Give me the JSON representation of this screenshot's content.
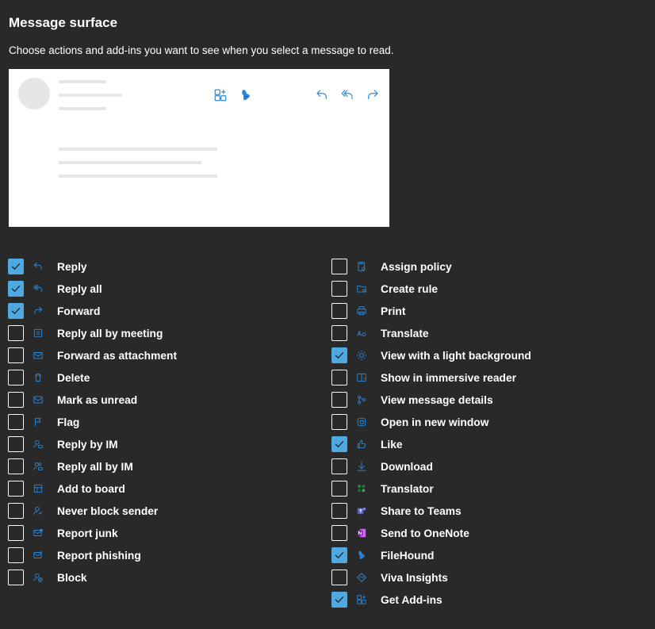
{
  "header": {
    "title": "Message surface",
    "subtitle": "Choose actions and add-ins you want to see when you select a message to read."
  },
  "preview": {
    "icons": [
      "add-ins-icon",
      "filehound-icon",
      "like-icon",
      "light-background-icon",
      "reply-icon",
      "reply-all-icon",
      "forward-icon"
    ]
  },
  "colors": {
    "background": "#292929",
    "accent": "#4fa8e0",
    "icon": "#2b88d8"
  },
  "left_options": [
    {
      "label": "Reply",
      "checked": true,
      "icon": "reply-icon"
    },
    {
      "label": "Reply all",
      "checked": true,
      "icon": "reply-all-icon"
    },
    {
      "label": "Forward",
      "checked": true,
      "icon": "forward-icon"
    },
    {
      "label": "Reply all by meeting",
      "checked": false,
      "icon": "calendar-reply-icon"
    },
    {
      "label": "Forward as attachment",
      "checked": false,
      "icon": "mail-attachment-icon"
    },
    {
      "label": "Delete",
      "checked": false,
      "icon": "trash-icon"
    },
    {
      "label": "Mark as unread",
      "checked": false,
      "icon": "envelope-icon"
    },
    {
      "label": "Flag",
      "checked": false,
      "icon": "flag-icon"
    },
    {
      "label": "Reply by IM",
      "checked": false,
      "icon": "person-chat-icon"
    },
    {
      "label": "Reply all by IM",
      "checked": false,
      "icon": "people-chat-icon"
    },
    {
      "label": "Add to board",
      "checked": false,
      "icon": "board-icon"
    },
    {
      "label": "Never block sender",
      "checked": false,
      "icon": "person-check-icon"
    },
    {
      "label": "Report junk",
      "checked": false,
      "icon": "mail-junk-icon"
    },
    {
      "label": "Report phishing",
      "checked": false,
      "icon": "mail-warning-icon"
    },
    {
      "label": "Block",
      "checked": false,
      "icon": "person-block-icon"
    }
  ],
  "right_options": [
    {
      "label": "Assign policy",
      "checked": false,
      "icon": "policy-icon"
    },
    {
      "label": "Create rule",
      "checked": false,
      "icon": "folder-rule-icon"
    },
    {
      "label": "Print",
      "checked": false,
      "icon": "printer-icon"
    },
    {
      "label": "Translate",
      "checked": false,
      "icon": "translate-icon"
    },
    {
      "label": "View with a light background",
      "checked": true,
      "icon": "sun-icon"
    },
    {
      "label": "Show in immersive reader",
      "checked": false,
      "icon": "immersive-reader-icon"
    },
    {
      "label": "View message details",
      "checked": false,
      "icon": "details-icon"
    },
    {
      "label": "Open in new window",
      "checked": false,
      "icon": "new-window-icon"
    },
    {
      "label": "Like",
      "checked": true,
      "icon": "thumbs-up-icon"
    },
    {
      "label": "Download",
      "checked": false,
      "icon": "download-icon"
    },
    {
      "label": "Translator",
      "checked": false,
      "icon": "translator-icon"
    },
    {
      "label": "Share to Teams",
      "checked": false,
      "icon": "teams-icon"
    },
    {
      "label": "Send to OneNote",
      "checked": false,
      "icon": "onenote-icon"
    },
    {
      "label": "FileHound",
      "checked": true,
      "icon": "filehound-icon"
    },
    {
      "label": "Viva Insights",
      "checked": false,
      "icon": "viva-insights-icon"
    },
    {
      "label": "Get Add-ins",
      "checked": true,
      "icon": "add-ins-icon"
    }
  ]
}
